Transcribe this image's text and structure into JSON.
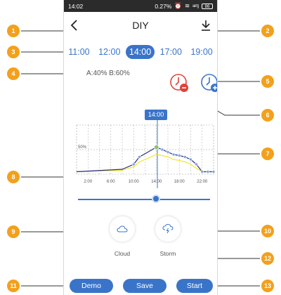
{
  "status_bar": {
    "time": "14:02",
    "speed": "0.27%",
    "signal_text": "ᵆᵗl",
    "battery": "86"
  },
  "header": {
    "title": "DIY"
  },
  "tabs": [
    "11:00",
    "12:00",
    "14:00",
    "17:00",
    "19:00"
  ],
  "active_tab": "14:00",
  "ratio": {
    "a": "A:40%",
    "b": "B:60%"
  },
  "chart": {
    "marker_label": "14:00",
    "y_label": "50%",
    "x_ticks": [
      "2:00",
      "6:00",
      "10:00",
      "14:00",
      "18:00",
      "22:00"
    ]
  },
  "chart_data": {
    "type": "line",
    "x": [
      0,
      8,
      10,
      11,
      14,
      15,
      16,
      17,
      18,
      19,
      20,
      21,
      22,
      23,
      24
    ],
    "series": [
      {
        "values": [
          5,
          10,
          20,
          35,
          55,
          50,
          45,
          40,
          38,
          35,
          30,
          20,
          5,
          5,
          5
        ]
      },
      {
        "values": [
          5,
          8,
          15,
          25,
          40,
          38,
          35,
          30,
          28,
          25,
          20,
          12,
          5,
          5,
          5
        ]
      }
    ],
    "ylim": [
      0,
      100
    ],
    "colors": [
      "#2a2f8a",
      "#f0e62c"
    ]
  },
  "weather": {
    "cloud_label": "Cloud",
    "storm_label": "Storm"
  },
  "buttons": {
    "demo": "Demo",
    "save": "Save",
    "start": "Start"
  },
  "callouts": [
    "1",
    "2",
    "3",
    "4",
    "5",
    "6",
    "7",
    "8",
    "9",
    "10",
    "11",
    "12",
    "13"
  ],
  "colors": {
    "accent": "#3a74c9",
    "callout": "#f3a01c",
    "delete": "#e0423a"
  }
}
